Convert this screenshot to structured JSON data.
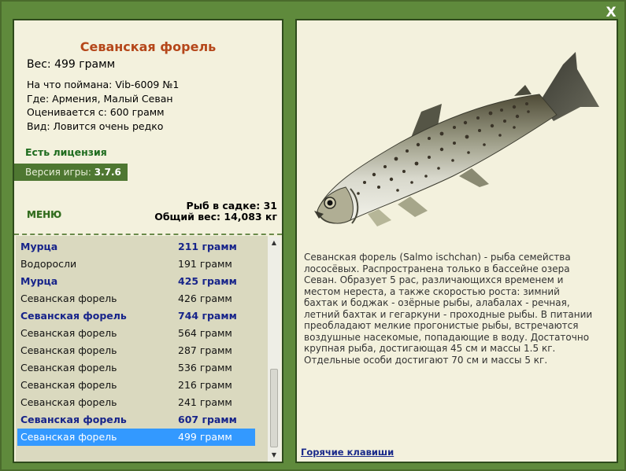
{
  "close_label": "X",
  "fish": {
    "title": "Севанская форель",
    "weight": "Вес: 499 грамм",
    "caught_with": "На что поймана: Vib-6009 №1",
    "location": "Где: Армения, Малый Севан",
    "valued_from": "Оценивается с: 600 грамм",
    "kind": "Вид: Ловится очень редко"
  },
  "license": "Есть лицензия",
  "version": {
    "label": "Версия игры:",
    "value": "3.7.6"
  },
  "menu_label": "МЕНЮ",
  "basket": {
    "count": "Рыб в садке: 31",
    "total": "Общий вес: 14,083 кг"
  },
  "catch_list": [
    {
      "name": "Мурца",
      "weight": "211 грамм",
      "bold": true
    },
    {
      "name": "Водоросли",
      "weight": "191 грамм",
      "bold": false
    },
    {
      "name": "Мурца",
      "weight": "425 грамм",
      "bold": true
    },
    {
      "name": "Севанская форель",
      "weight": "426 грамм",
      "bold": false
    },
    {
      "name": "Севанская форель",
      "weight": "744 грамм",
      "bold": true
    },
    {
      "name": "Севанская форель",
      "weight": "564 грамм",
      "bold": false
    },
    {
      "name": "Севанская форель",
      "weight": "287 грамм",
      "bold": false
    },
    {
      "name": "Севанская форель",
      "weight": "536 грамм",
      "bold": false
    },
    {
      "name": "Севанская форель",
      "weight": "216 грамм",
      "bold": false
    },
    {
      "name": "Севанская форель",
      "weight": "241 грамм",
      "bold": false
    },
    {
      "name": "Севанская форель",
      "weight": "607 грамм",
      "bold": true
    },
    {
      "name": "Севанская форель",
      "weight": "499 грамм",
      "bold": false,
      "selected": true
    }
  ],
  "description": "Севанская форель (Salmo ischchan) - рыба семейства лососёвых. Распространена только в бассейне озера Севан. Образует 5 рас, различающихся временем и местом нереста, а также скоростью роста: зимний бахтак и боджак - озёрные рыбы, алабалах - речная, летний бахтак и гегаркуни - проходные рыбы. В питании преобладают мелкие прогонистые рыбы, встречаются воздушные насекомые, попадающие в воду. Достаточно крупная рыба, достигающая 45 см и массы 1.5 кг. Отдельные особи достигают 70 см и массы 5 кг.",
  "hotkeys_label": "Горячие клавиши",
  "icons": {
    "close": "close-icon",
    "scroll_up": "arrow-up-icon",
    "scroll_down": "arrow-down-icon"
  }
}
